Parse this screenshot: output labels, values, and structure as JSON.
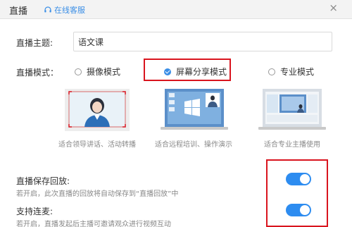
{
  "header": {
    "title": "直播",
    "service_label": "在线客服",
    "close": "×"
  },
  "topic": {
    "label": "直播主题:",
    "value": "语文课"
  },
  "mode": {
    "label": "直播模式：",
    "options": [
      {
        "label": "摄像模式",
        "checked": false,
        "caption": "适合领导讲话、活动转播"
      },
      {
        "label": "屏幕分享模式",
        "checked": true,
        "caption": "适合远程培训、操作演示"
      },
      {
        "label": "专业模式",
        "checked": false,
        "caption": "适合专业主播使用"
      }
    ]
  },
  "settings": [
    {
      "label": "直播保存回放:",
      "desc": "若开启，此次直播的回放将自动保存到“直播回放”中",
      "enabled": true
    },
    {
      "label": "支持连麦:",
      "desc": "若开启，直播发起后主播可邀请观众进行视频互动",
      "enabled": true
    }
  ],
  "colors": {
    "accent": "#3a8ee6",
    "toggle": "#2d8cf0",
    "highlight": "#d9141e"
  }
}
